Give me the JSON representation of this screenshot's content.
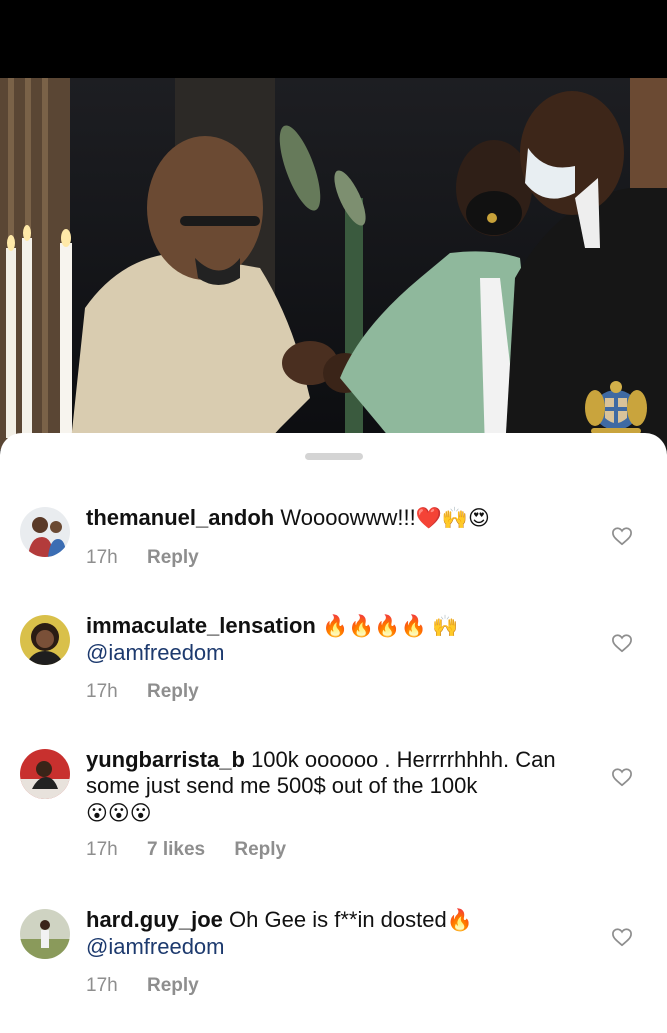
{
  "comments": [
    {
      "username": "themanuel_andoh",
      "text": "Woooowww!!!",
      "emoji": "❤️🙌😍",
      "mention": "",
      "time": "17h",
      "likes": "",
      "reply_label": "Reply"
    },
    {
      "username": "immaculate_lensation",
      "text": "",
      "emoji": "🔥🔥🔥🔥 🙌",
      "mention": "@iamfreedom",
      "time": "17h",
      "likes": "",
      "reply_label": "Reply"
    },
    {
      "username": "yungbarrista_b",
      "text": "100k oooooo .  Herrrrhhhh. Can some just send me 500$ out of the 100k",
      "emoji": "😮😮😮",
      "mention": "",
      "time": "17h",
      "likes": "7 likes",
      "reply_label": "Reply"
    },
    {
      "username": "hard.guy_joe",
      "text": "Oh Gee is f**in dosted",
      "emoji": "🔥",
      "mention": "@iamfreedom",
      "time": "17h",
      "likes": "",
      "reply_label": "Reply"
    }
  ],
  "icons": {
    "like": "heart-outline-icon",
    "crest": "coat-of-arms-icon"
  },
  "colors": {
    "sheet": "#ffffff",
    "meta_text": "#8e8e8e",
    "mention": "#1d3a6e",
    "heart_stroke": "#8e8e8e"
  }
}
